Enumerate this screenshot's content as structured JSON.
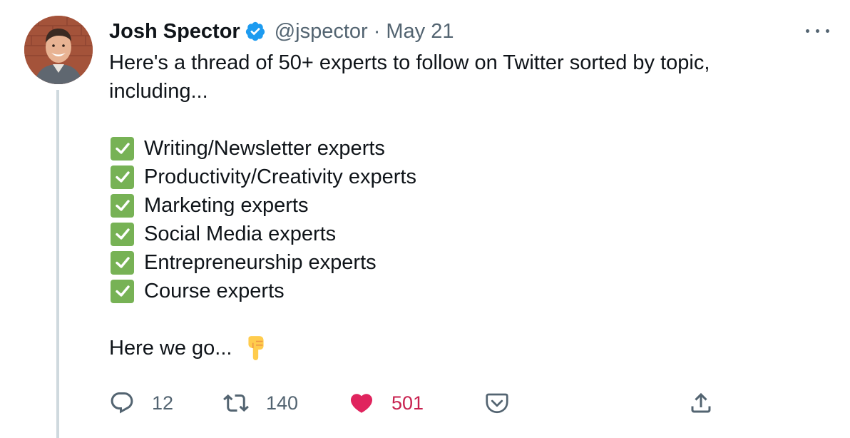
{
  "author": {
    "name": "Josh Spector",
    "verified_icon": "verified-badge-icon",
    "handle": "@jspector",
    "separator": "·",
    "date": "May 21"
  },
  "body": {
    "intro": "Here's a thread of 50+ experts to follow on Twitter sorted by topic, including...",
    "bullet_icon": "check-mark-button-emoji",
    "bullets": [
      "Writing/Newsletter experts",
      "Productivity/Creativity experts",
      "Marketing experts",
      "Social Media experts",
      "Entrepreneurship experts",
      "Course experts"
    ],
    "outro": "Here we go...",
    "outro_emoji": "backhand-index-pointing-down-emoji"
  },
  "actions": {
    "reply": {
      "icon": "reply-icon",
      "count": "12"
    },
    "retweet": {
      "icon": "retweet-icon",
      "count": "140"
    },
    "like": {
      "icon": "heart-icon",
      "count": "501",
      "liked": true,
      "color": "#e0245e"
    },
    "pocket": {
      "icon": "pocket-icon"
    },
    "share": {
      "icon": "share-icon"
    }
  },
  "colors": {
    "text": "#0f1419",
    "secondary": "#536471",
    "verified": "#1d9bf0",
    "check_green": "#77b255",
    "like_red": "#e0245e",
    "thread_line": "#cfd9de"
  }
}
